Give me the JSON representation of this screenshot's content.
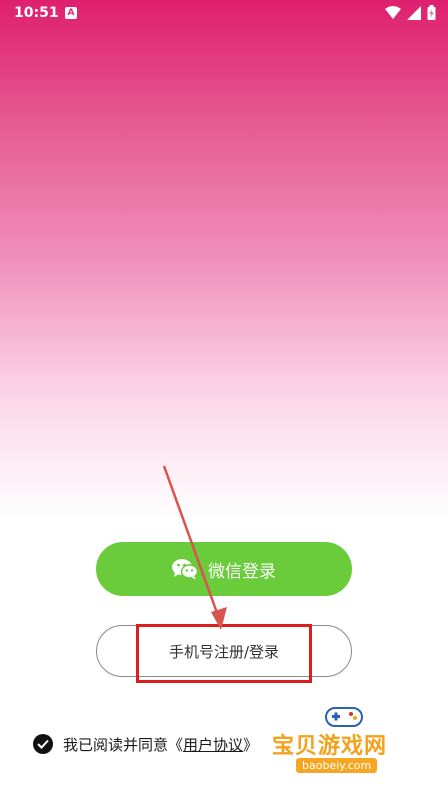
{
  "status_bar": {
    "time": "10:51",
    "app_icon_letter": "A",
    "wifi_icon": "wifi-icon",
    "signal_icon": "signal-icon",
    "battery_icon": "battery-icon"
  },
  "buttons": {
    "wechat_login": "微信登录",
    "phone_login": "手机号注册/登录"
  },
  "agreement": {
    "prefix": "我已阅读并同意",
    "open_quote": "《",
    "user_agreement": "用户协议",
    "close_quote": "》"
  },
  "watermark": {
    "text": "宝贝游戏网",
    "url": "baobeiy.com"
  },
  "colors": {
    "gradient_top": "#df1f6d",
    "wechat_green": "#6acb3b",
    "annotation_red": "#d91f1f"
  }
}
